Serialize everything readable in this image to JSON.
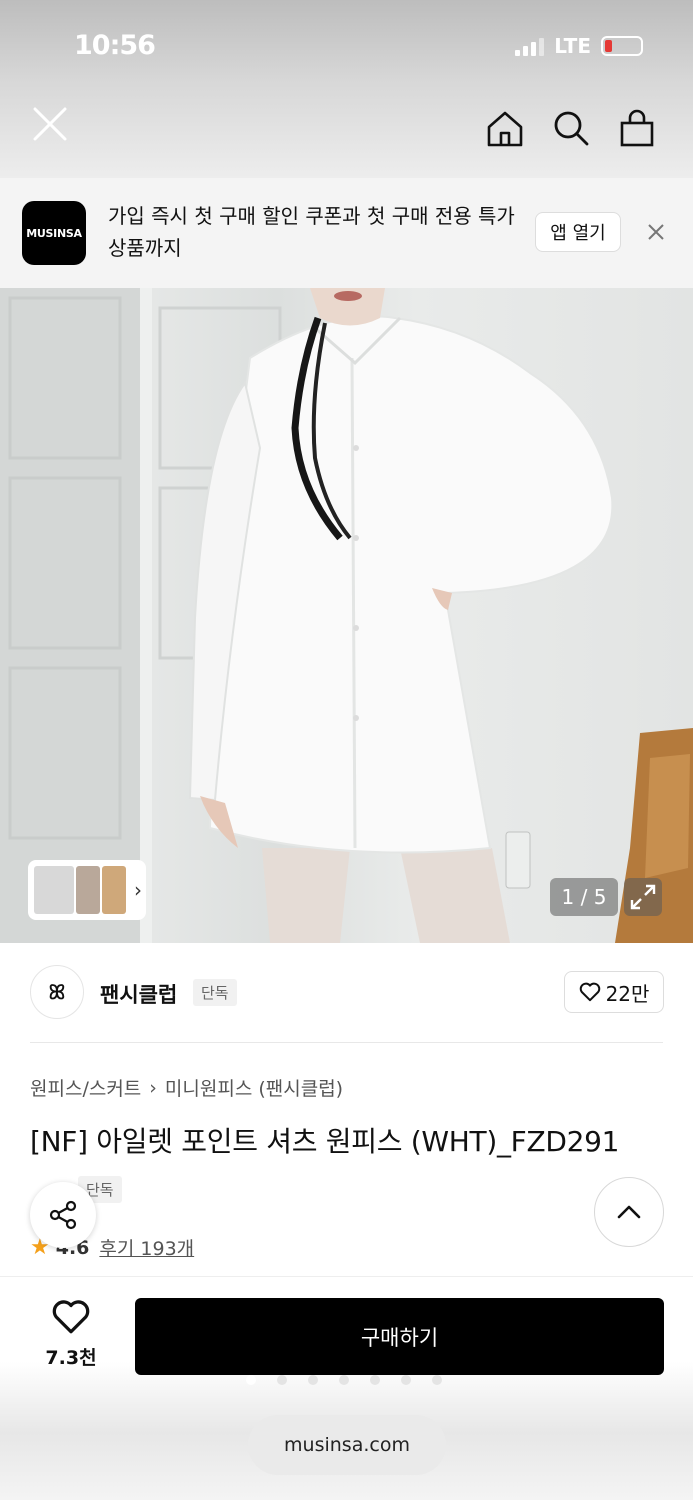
{
  "status_bar": {
    "time": "10:56",
    "network": "LTE",
    "battery_level": 0.15
  },
  "browser_nav": {
    "close_icon": "close-icon",
    "icons": [
      "home-icon",
      "search-icon",
      "bag-icon"
    ]
  },
  "app_banner": {
    "logo_text": "MUSINSA",
    "message": "가입 즉시 첫 구매 할인 쿠폰과 첫 구매 전용 특가 상품까지",
    "open_label": "앱 열기",
    "close_icon": "close-icon"
  },
  "product_image": {
    "counter": "1 / 5",
    "thumbnail_icon": "chevron-right-icon",
    "expand_icon": "expand-icon"
  },
  "brand": {
    "logo_text": "ꕤ",
    "name": "팬시클럽",
    "exclusive_badge": "단독",
    "like_count": "22만"
  },
  "product": {
    "breadcrumb": [
      "원피스/스커트",
      "미니원피스 (팬시클럽)"
    ],
    "title": "[NF] 아일렛 포인트 셔츠 원피스 (WHT)_FZD291",
    "tag": "단독",
    "rating": "4.6",
    "reviews": "후기 193개"
  },
  "bottom_bar": {
    "wishlist_count": "7.3천",
    "buy_label": "구매하기",
    "url": "musinsa.com"
  },
  "colors": {
    "buy_button": "#000000",
    "star": "#f4a01b",
    "battery_low": "#e53935"
  }
}
